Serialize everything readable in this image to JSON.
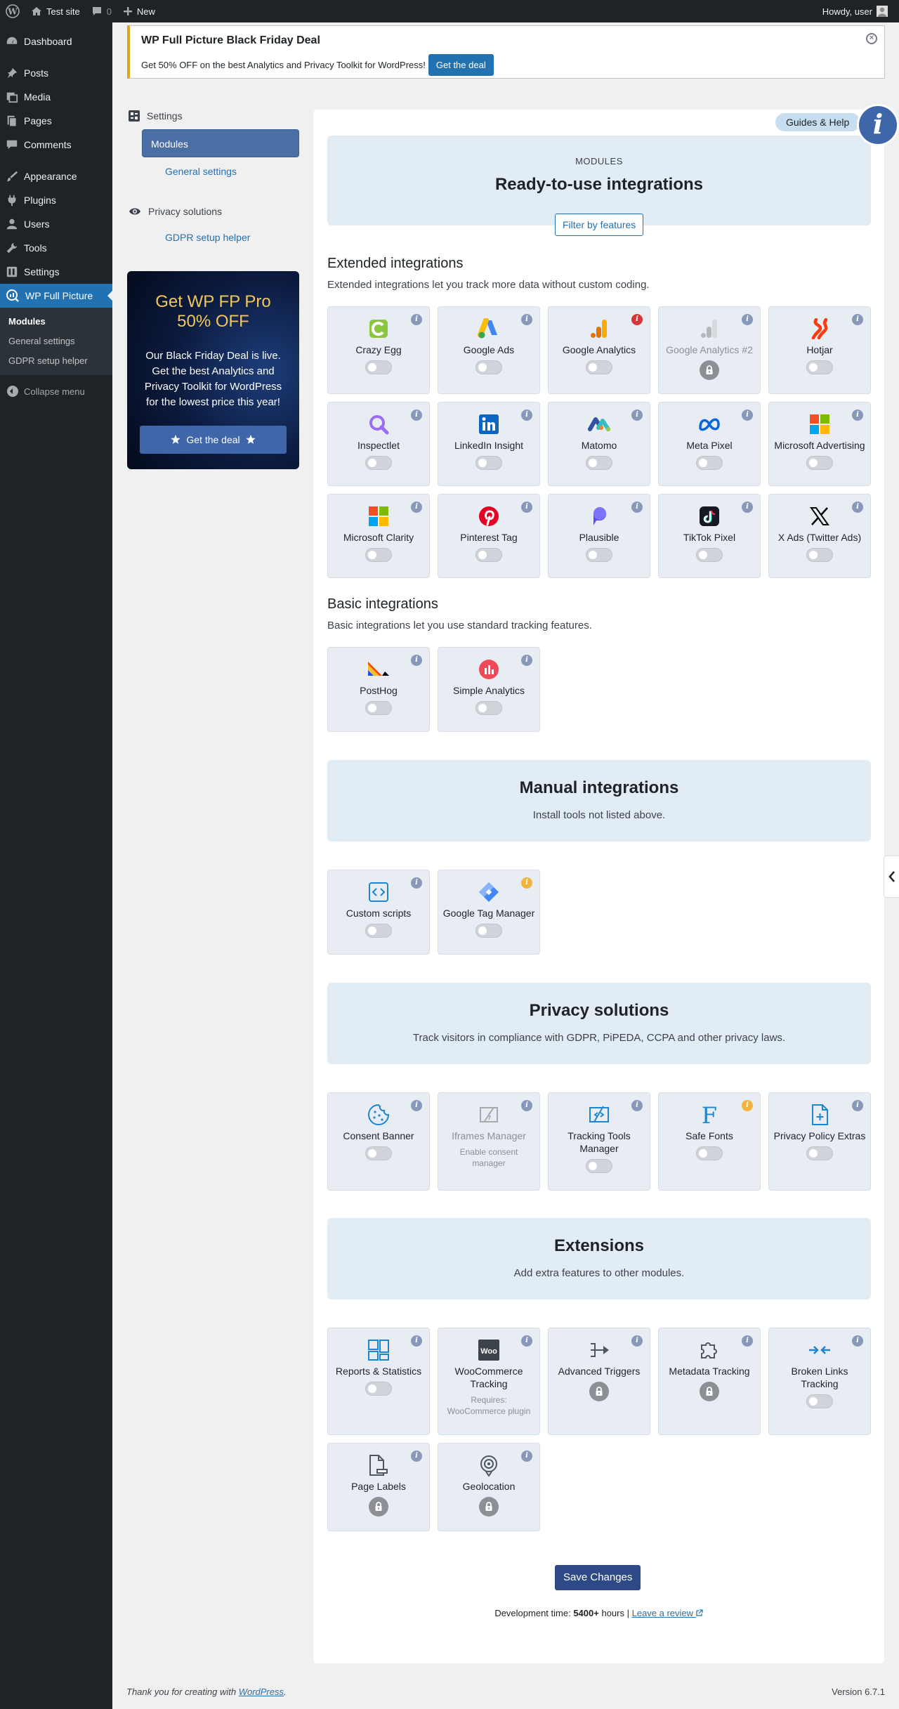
{
  "adminbar": {
    "site_name": "Test site",
    "comments_count": "0",
    "new_label": "New",
    "howdy": "Howdy, user"
  },
  "sidebar": {
    "items": [
      {
        "label": "Dashboard",
        "icon": "dashboard-icon"
      },
      {
        "label": "Posts",
        "icon": "pin-icon"
      },
      {
        "label": "Media",
        "icon": "media-icon"
      },
      {
        "label": "Pages",
        "icon": "pages-icon"
      },
      {
        "label": "Comments",
        "icon": "comment-icon"
      },
      {
        "label": "Appearance",
        "icon": "brush-icon"
      },
      {
        "label": "Plugins",
        "icon": "plugin-icon"
      },
      {
        "label": "Users",
        "icon": "user-icon"
      },
      {
        "label": "Tools",
        "icon": "wrench-icon"
      },
      {
        "label": "Settings",
        "icon": "settings-icon"
      },
      {
        "label": "WP Full Picture",
        "icon": "chart-icon"
      }
    ],
    "submenu": [
      "Modules",
      "General settings",
      "GDPR setup helper"
    ],
    "collapse_label": "Collapse menu"
  },
  "notice": {
    "title": "WP Full Picture Black Friday Deal",
    "text": "Get 50% OFF on the best Analytics and Privacy Toolkit for WordPress!",
    "button": "Get the deal"
  },
  "nav": {
    "settings_label": "Settings",
    "links": [
      "Modules",
      "General settings"
    ],
    "privacy_label": "Privacy solutions",
    "privacy_links": [
      "GDPR setup helper"
    ]
  },
  "promo": {
    "heading": "Get WP FP Pro 50% OFF",
    "text": "Our Black Friday Deal is live. Get the best Analytics and Privacy Toolkit for WordPress for the lowest price this year!",
    "button": "Get the deal"
  },
  "header": {
    "guides": "Guides & Help",
    "info": "i",
    "eyebrow": "MODULES",
    "title": "Ready-to-use integrations",
    "filter": "Filter by features"
  },
  "extended": {
    "title": "Extended integrations",
    "desc": "Extended integrations let you track more data without custom coding.",
    "cards": [
      {
        "name": "Crazy Egg",
        "state": "toggle"
      },
      {
        "name": "Google Ads",
        "state": "toggle"
      },
      {
        "name": "Google Analytics",
        "state": "toggle",
        "info": "red"
      },
      {
        "name": "Google Analytics #2",
        "state": "lock",
        "dim": true
      },
      {
        "name": "Hotjar",
        "state": "toggle"
      },
      {
        "name": "Inspectlet",
        "state": "toggle"
      },
      {
        "name": "LinkedIn Insight",
        "state": "toggle"
      },
      {
        "name": "Matomo",
        "state": "toggle"
      },
      {
        "name": "Meta Pixel",
        "state": "toggle"
      },
      {
        "name": "Microsoft Advertising",
        "state": "toggle"
      },
      {
        "name": "Microsoft Clarity",
        "state": "toggle"
      },
      {
        "name": "Pinterest Tag",
        "state": "toggle"
      },
      {
        "name": "Plausible",
        "state": "toggle"
      },
      {
        "name": "TikTok Pixel",
        "state": "toggle"
      },
      {
        "name": "X Ads (Twitter Ads)",
        "state": "toggle"
      }
    ]
  },
  "basic": {
    "title": "Basic integrations",
    "desc": "Basic integrations let you use standard tracking features.",
    "cards": [
      {
        "name": "PostHog",
        "state": "toggle"
      },
      {
        "name": "Simple Analytics",
        "state": "toggle"
      }
    ]
  },
  "manual": {
    "title": "Manual integrations",
    "desc": "Install tools not listed above.",
    "cards": [
      {
        "name": "Custom scripts",
        "state": "toggle"
      },
      {
        "name": "Google Tag Manager",
        "state": "toggle",
        "info": "yellow"
      }
    ]
  },
  "privacy": {
    "title": "Privacy solutions",
    "desc": "Track visitors in compliance with GDPR, PiPEDA, CCPA and other privacy laws.",
    "cards": [
      {
        "name": "Consent Banner",
        "state": "toggle"
      },
      {
        "name": "Iframes Manager",
        "state": "note",
        "note": "Enable consent manager",
        "dim": true
      },
      {
        "name": "Tracking Tools Manager",
        "state": "toggle"
      },
      {
        "name": "Safe Fonts",
        "state": "toggle",
        "info": "yellow"
      },
      {
        "name": "Privacy Policy Extras",
        "state": "toggle"
      }
    ]
  },
  "extensions": {
    "title": "Extensions",
    "desc": "Add extra features to other modules.",
    "cards": [
      {
        "name": "Reports & Statistics",
        "state": "toggle"
      },
      {
        "name": "WooCommerce Tracking",
        "state": "note",
        "note": "Requires: WooCommerce plugin"
      },
      {
        "name": "Advanced Triggers",
        "state": "lock"
      },
      {
        "name": "Metadata Tracking",
        "state": "lock"
      },
      {
        "name": "Broken Links Tracking",
        "state": "toggle"
      },
      {
        "name": "Page Labels",
        "state": "lock"
      },
      {
        "name": "Geolocation",
        "state": "lock"
      }
    ]
  },
  "save": "Save Changes",
  "devtime": {
    "prefix": "Development time:",
    "hours": "5400+",
    "suffix": "hours |",
    "review": "Leave a review"
  },
  "footer": {
    "text": "Thank you for creating with",
    "link": "WordPress",
    "version": "Version 6.7.1"
  },
  "colors": {
    "accent": "#2271b1",
    "sidebar": "#1d2327",
    "band": "#e2ecf5",
    "card": "#e8edf3",
    "promo_heading": "#f1c75b"
  }
}
